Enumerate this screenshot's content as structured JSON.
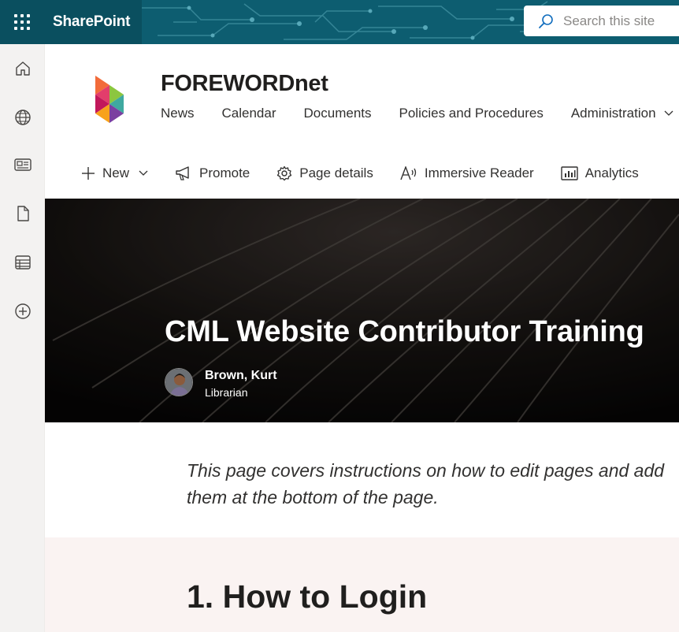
{
  "suite": {
    "app_name": "SharePoint",
    "search_placeholder": "Search this site"
  },
  "left_rail": {
    "icons": [
      "home-icon",
      "globe-icon",
      "news-icon",
      "document-icon",
      "list-icon",
      "add-circle-icon"
    ]
  },
  "site": {
    "title": "FOREWORDnet",
    "nav": [
      "News",
      "Calendar",
      "Documents",
      "Policies and Procedures",
      "Administration"
    ]
  },
  "commands": {
    "new": "New",
    "promote": "Promote",
    "page_details": "Page details",
    "immersive_reader": "Immersive Reader",
    "analytics": "Analytics"
  },
  "hero": {
    "title": "CML Website Contributor Training",
    "author_name": "Brown, Kurt",
    "author_role": "Librarian"
  },
  "content": {
    "intro_line1": "This page covers instructions on how to edit pages and add",
    "intro_line2": "them at the bottom of the page.",
    "section_heading": "1. How to Login"
  },
  "colors": {
    "suite_bar": "#0c5a6c",
    "left_rail": "#f3f2f1",
    "section_bg": "#faf3f2"
  }
}
